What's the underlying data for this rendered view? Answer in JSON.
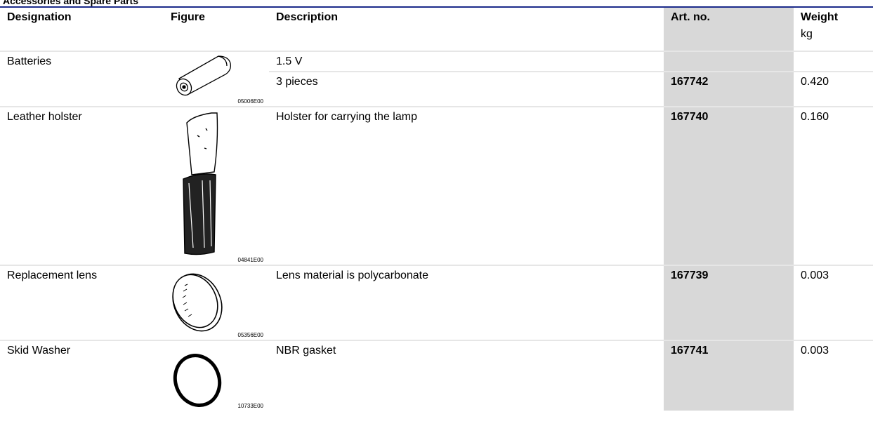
{
  "section_title": "Accessories and Spare Parts",
  "headers": {
    "designation": "Designation",
    "figure": "Figure",
    "description": "Description",
    "art_no": "Art. no.",
    "weight": "Weight",
    "weight_unit": "kg"
  },
  "rows": [
    {
      "designation": "Batteries",
      "figure_code": "05006E00",
      "figure_icon": "battery-icon",
      "lines": [
        {
          "description": "1.5 V",
          "art_no": "",
          "weight": ""
        },
        {
          "description": "3 pieces",
          "art_no": "167742",
          "weight": "0.420"
        }
      ]
    },
    {
      "designation": "Leather holster",
      "figure_code": "04841E00",
      "figure_icon": "holster-icon",
      "lines": [
        {
          "description": "Holster for carrying the lamp",
          "art_no": "167740",
          "weight": "0.160"
        }
      ]
    },
    {
      "designation": "Replacement lens",
      "figure_code": "05356E00",
      "figure_icon": "lens-icon",
      "lines": [
        {
          "description": "Lens material is polycarbonate",
          "art_no": "167739",
          "weight": "0.003"
        }
      ]
    },
    {
      "designation": "Skid Washer",
      "figure_code": "10733E00",
      "figure_icon": "washer-icon",
      "lines": [
        {
          "description": "NBR gasket",
          "art_no": "167741",
          "weight": "0.003"
        }
      ]
    }
  ]
}
